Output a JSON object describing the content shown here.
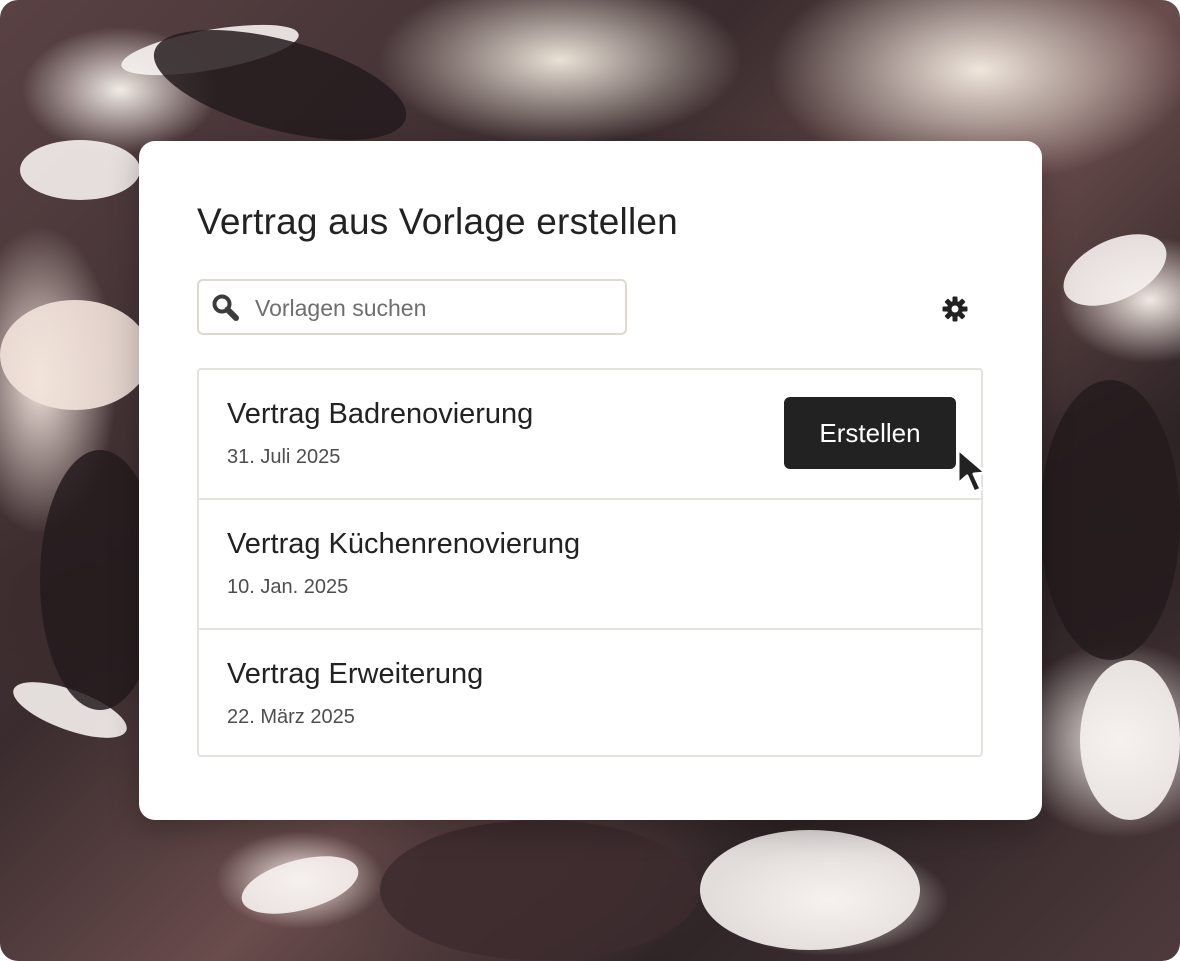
{
  "dialog": {
    "title": "Vertrag aus Vorlage erstellen",
    "search": {
      "placeholder": "Vorlagen suchen",
      "value": ""
    },
    "icons": {
      "search": "search-icon",
      "settings": "gear-icon",
      "pointer": "mouse-pointer-icon"
    },
    "templates": [
      {
        "name": "Vertrag Badrenovierung",
        "date": "31. Juli 2025",
        "action_label": "Erstellen"
      },
      {
        "name": "Vertrag Küchenrenovierung",
        "date": "10. Jan. 2025"
      },
      {
        "name": "Vertrag Erweiterung",
        "date": "22. März 2025"
      }
    ]
  },
  "colors": {
    "card_background": "#ffffff",
    "text_primary": "#222222",
    "text_secondary": "#4e4e4e",
    "button_background": "#222222",
    "button_text": "#ffffff",
    "border": "#e4e2dc"
  }
}
